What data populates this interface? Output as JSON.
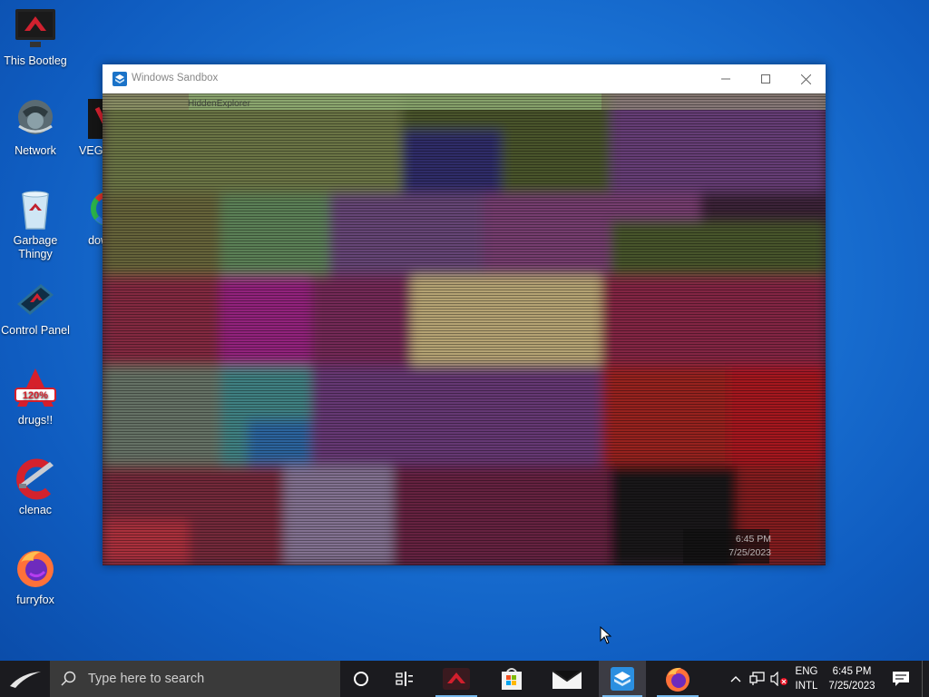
{
  "desktop": {
    "icons": [
      {
        "label": "This Bootleg",
        "icon": "monitor-icon"
      },
      {
        "label": "Network",
        "icon": "globe-network-icon"
      },
      {
        "label": "Garbage Thingy",
        "icon": "recycle-bin-icon"
      },
      {
        "label": "Control Panel",
        "icon": "control-panel-icon"
      },
      {
        "label": "drugs!!",
        "icon": "120-percent-icon"
      },
      {
        "label": "clenac",
        "icon": "ccleaner-icon"
      },
      {
        "label": "furryfox",
        "icon": "firefox-icon"
      },
      {
        "label": "VEGA Crac",
        "icon": "vegas-icon"
      },
      {
        "label": "down th",
        "icon": "download-app-icon"
      }
    ]
  },
  "window": {
    "title": "Windows Sandbox",
    "glitched_title": "HiddenExplorer",
    "glitched_time": "6:45 PM",
    "glitched_date": "7/25/2023"
  },
  "taskbar": {
    "search_placeholder": "Type here to search",
    "tray": {
      "lang": "ENG",
      "layout": "INTL",
      "time": "6:45 PM",
      "date": "7/25/2023"
    }
  },
  "colors": {
    "desktop_bg": "#1b74d6",
    "taskbar_bg": "#1b1b1f",
    "accent": "#76b9ed"
  }
}
